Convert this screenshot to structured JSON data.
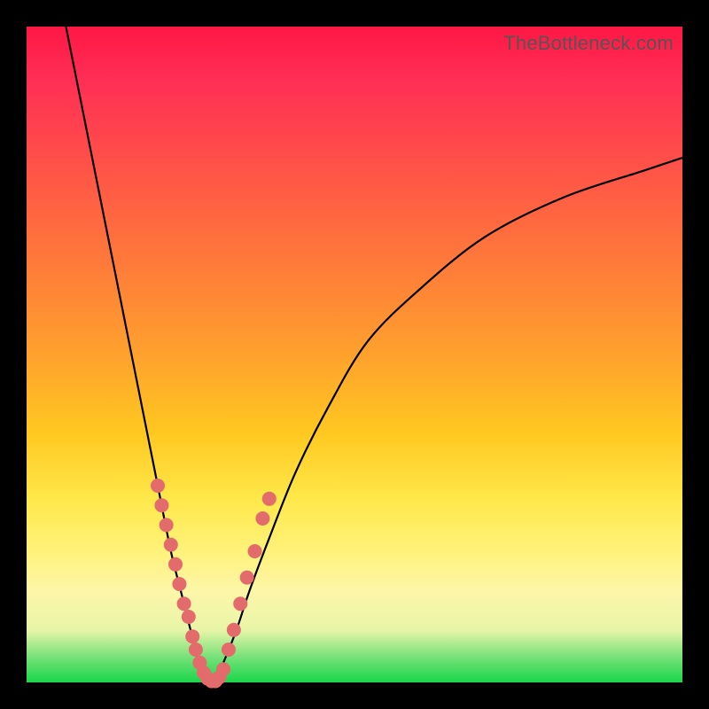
{
  "watermark": "TheBottleneck.com",
  "chart_data": {
    "type": "line",
    "title": "",
    "xlabel": "",
    "ylabel": "",
    "xlim": [
      0,
      100
    ],
    "ylim": [
      0,
      100
    ],
    "grid": false,
    "legend": false,
    "series": [
      {
        "name": "left-branch",
        "x": [
          6,
          8,
          10,
          12,
          14,
          16,
          18,
          20,
          22,
          23.5,
          25,
          26,
          27,
          28
        ],
        "y": [
          100,
          90,
          80,
          70,
          60,
          50,
          40,
          30,
          20,
          14,
          8,
          4,
          1.5,
          0
        ]
      },
      {
        "name": "right-branch",
        "x": [
          28,
          29,
          30,
          32,
          34,
          37,
          41,
          46,
          52,
          60,
          70,
          82,
          94,
          100
        ],
        "y": [
          0,
          1,
          3,
          8,
          14,
          22,
          32,
          42,
          52,
          60,
          68,
          74,
          78,
          80
        ]
      }
    ],
    "markers": {
      "name": "highlight-points",
      "color": "#e36b6b",
      "points_xy": [
        [
          20.0,
          30
        ],
        [
          20.6,
          27
        ],
        [
          21.3,
          24
        ],
        [
          22.0,
          21
        ],
        [
          22.7,
          18
        ],
        [
          23.3,
          15
        ],
        [
          24.0,
          12
        ],
        [
          24.7,
          10
        ],
        [
          25.3,
          7
        ],
        [
          25.8,
          5
        ],
        [
          26.4,
          3
        ],
        [
          27.0,
          1.5
        ],
        [
          27.6,
          0.6
        ],
        [
          28.2,
          0.2
        ],
        [
          28.8,
          0.2
        ],
        [
          29.4,
          0.8
        ],
        [
          30.0,
          2
        ],
        [
          30.8,
          5
        ],
        [
          31.6,
          8
        ],
        [
          32.6,
          12
        ],
        [
          33.6,
          16
        ],
        [
          34.8,
          20
        ],
        [
          36.0,
          25
        ],
        [
          37.0,
          28
        ]
      ]
    }
  }
}
